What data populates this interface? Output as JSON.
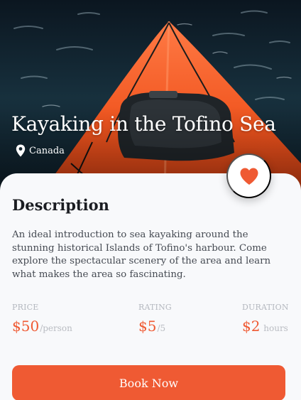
{
  "tour": {
    "title": "Kayaking in the Tofino Sea",
    "location": "Canada",
    "location_icon": "location-pin-icon",
    "favorite_icon": "heart-icon",
    "favorited": true
  },
  "description": {
    "heading": "Description",
    "body": "An ideal introduction to sea kayaking around the stunning historical Islands of Tofino's harbour. Come explore the spectacular scenery of the area and learn what makes the area so fascinating."
  },
  "stats": {
    "price": {
      "label": "PRICE",
      "value": "$50",
      "unit": "/person"
    },
    "rating": {
      "label": "RATING",
      "value": "$5",
      "unit": "/5"
    },
    "duration": {
      "label": "DURATION",
      "value": "$2",
      "unit": " hours"
    }
  },
  "actions": {
    "book_label": "Book Now"
  },
  "colors": {
    "accent": "#ef5a33",
    "card_background": "#f8f9fb",
    "heading_text": "#1b1d22",
    "muted_text": "#b4b8bf"
  }
}
